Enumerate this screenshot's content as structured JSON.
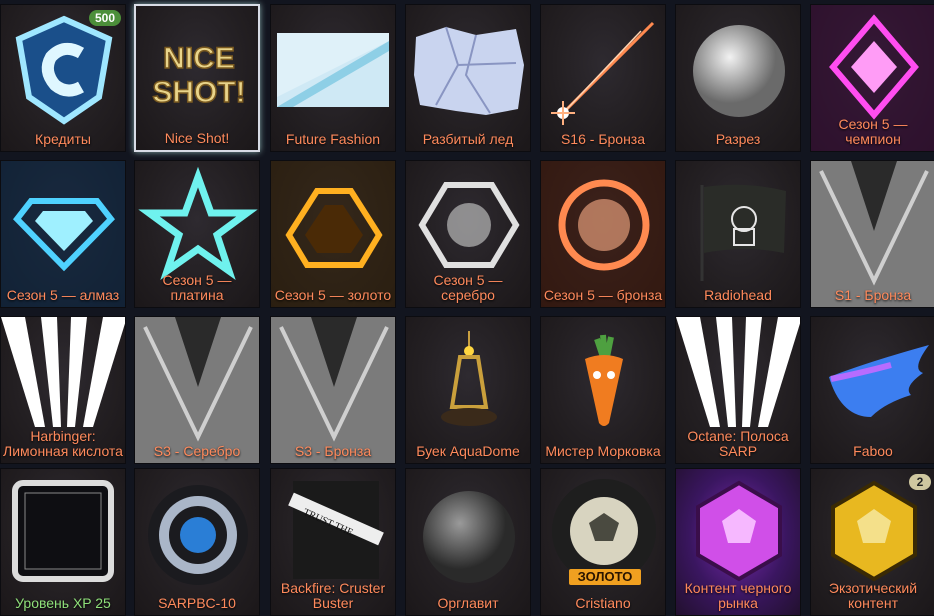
{
  "tiles": [
    {
      "label": "Кредиты",
      "icon": "credits-shield-icon",
      "badge": "500"
    },
    {
      "label": "Nice Shot!",
      "icon": "nice-shot-decal-icon"
    },
    {
      "label": "Future Fashion",
      "icon": "future-fashion-banner-icon"
    },
    {
      "label": "Разбитый лед",
      "icon": "broken-ice-icon"
    },
    {
      "label": "S16 - Бронза",
      "icon": "s16-bronze-trail-icon"
    },
    {
      "label": "Разрез",
      "icon": "metal-ball-icon"
    },
    {
      "label": "Сезон 5 — чемпион",
      "icon": "season5-champion-icon"
    },
    {
      "label": "Сезон 5 — алмаз",
      "icon": "season5-diamond-icon"
    },
    {
      "label": "Сезон 5 — платина",
      "icon": "season5-platinum-star-icon"
    },
    {
      "label": "Сезон 5 — золото",
      "icon": "season5-gold-icon"
    },
    {
      "label": "Сезон 5 — серебро",
      "icon": "season5-silver-icon"
    },
    {
      "label": "Сезон 5 — бронза",
      "icon": "season5-bronze-icon"
    },
    {
      "label": "Radiohead",
      "icon": "radiohead-flag-icon"
    },
    {
      "label": "S1 - Бронза",
      "icon": "s1-bronze-banner-icon"
    },
    {
      "label": "Harbinger: Лимонная кислота",
      "icon": "harbinger-banner-icon"
    },
    {
      "label": "S3 - Серебро",
      "icon": "s3-silver-banner-icon"
    },
    {
      "label": "S3 - Бронза",
      "icon": "s3-bronze-banner-icon"
    },
    {
      "label": "Буек AquaDome",
      "icon": "aquadome-buoy-icon"
    },
    {
      "label": "Мистер Морковка",
      "icon": "mister-carrot-icon"
    },
    {
      "label": "Octane: Полоса SARP",
      "icon": "octane-sarp-banner-icon"
    },
    {
      "label": "Faboo",
      "icon": "faboo-wing-icon"
    },
    {
      "label": "Уровень XP 25",
      "icon": "xp-level-frame-icon",
      "label_color": "green"
    },
    {
      "label": "SARPBC-10",
      "icon": "sarpbc-wheel-icon"
    },
    {
      "label": "Backfire: Cruster Buster",
      "icon": "trust-the-crust-banner-icon"
    },
    {
      "label": "Орглавит",
      "icon": "orglavit-ball-icon"
    },
    {
      "label": "Cristiano",
      "icon": "cristiano-wheel-icon",
      "tag": "ЗОЛОТО"
    },
    {
      "label": "Контент черного рынка",
      "icon": "black-market-drop-icon",
      "purple": true
    },
    {
      "label": "Экзотический контент",
      "icon": "exotic-drop-icon",
      "badge": "2",
      "badge_style": "gold"
    }
  ]
}
